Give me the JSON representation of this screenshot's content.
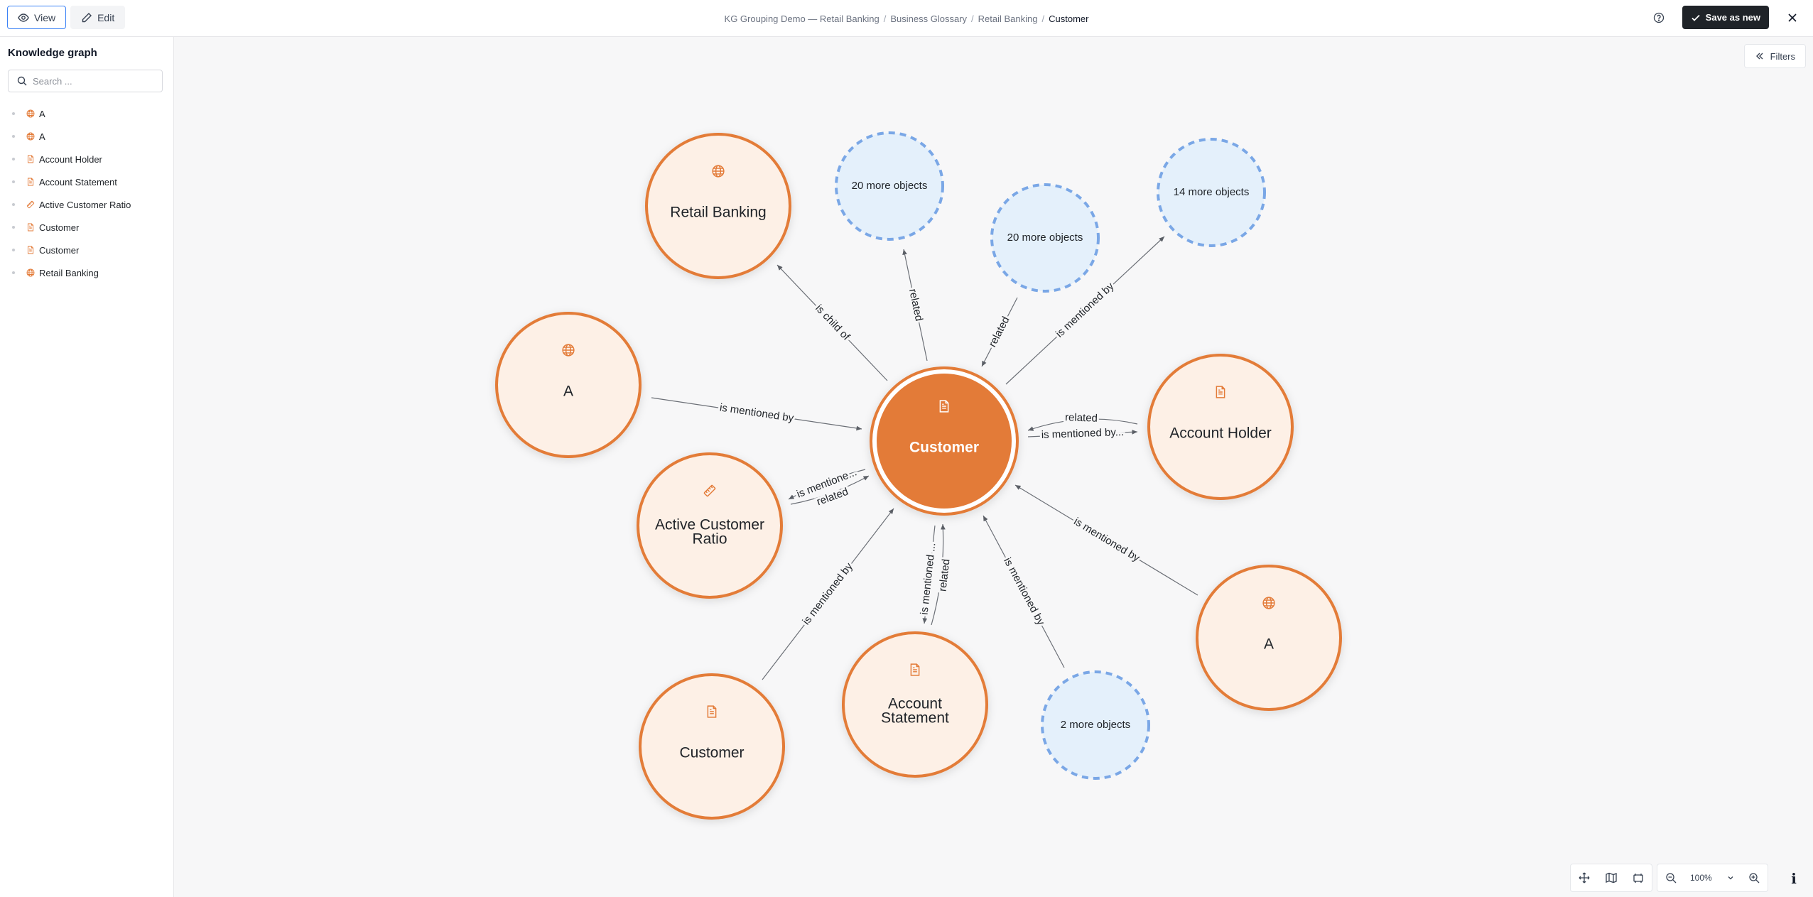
{
  "toolbar": {
    "view_label": "View",
    "edit_label": "Edit",
    "save_label": "Save as new"
  },
  "breadcrumb": {
    "root": "KG Grouping Demo — Retail Banking",
    "items": [
      "Business Glossary",
      "Retail Banking"
    ],
    "current": "Customer",
    "separator": "/"
  },
  "sidebar": {
    "title": "Knowledge graph",
    "search_placeholder": "Search ...",
    "items": [
      {
        "label": "A",
        "icon": "globe-icon"
      },
      {
        "label": "A",
        "icon": "globe-icon"
      },
      {
        "label": "Account Holder",
        "icon": "document-icon"
      },
      {
        "label": "Account Statement",
        "icon": "document-icon"
      },
      {
        "label": "Active Customer Ratio",
        "icon": "ruler-icon"
      },
      {
        "label": "Customer",
        "icon": "document-icon"
      },
      {
        "label": "Customer",
        "icon": "document-icon"
      },
      {
        "label": "Retail Banking",
        "icon": "globe-icon"
      }
    ]
  },
  "canvas": {
    "filters_label": "Filters",
    "zoom_level": "100%"
  },
  "graph": {
    "center": {
      "label": "Customer",
      "icon": "document-icon"
    },
    "nodes": [
      {
        "label": "Retail Banking",
        "icon": "globe-icon"
      },
      {
        "label": "A",
        "icon": "globe-icon"
      },
      {
        "label": "Active Customer Ratio",
        "icon": "ruler-icon"
      },
      {
        "label": "Customer",
        "icon": "document-icon"
      },
      {
        "label": "Account Statement",
        "icon": "document-icon"
      },
      {
        "label": "Account Holder",
        "icon": "document-icon"
      },
      {
        "label": "A",
        "icon": "globe-icon"
      }
    ],
    "groups": [
      {
        "label": "20 more objects"
      },
      {
        "label": "20 more objects"
      },
      {
        "label": "14 more objects"
      },
      {
        "label": "2 more objects"
      }
    ],
    "edge_labels": {
      "retail_banking": "is child of",
      "group1": "related",
      "group2": "related",
      "group3": "is mentioned by",
      "a_left": "is mentioned by",
      "holder_related": "related",
      "holder_mentioned": "is mentioned by...",
      "acr_mentioned": "is mentione...",
      "acr_related": "related",
      "customer_bottom": "is mentioned by",
      "statement_mentioned": "is mentioned ...",
      "statement_related": "related",
      "group4": "is mentioned by",
      "a_right": "is mentioned by"
    },
    "colors": {
      "accent": "#e37b38",
      "node_fill": "#fdf0e6",
      "group_fill": "#e4f0fb",
      "group_stroke": "#7aa7e6"
    }
  }
}
